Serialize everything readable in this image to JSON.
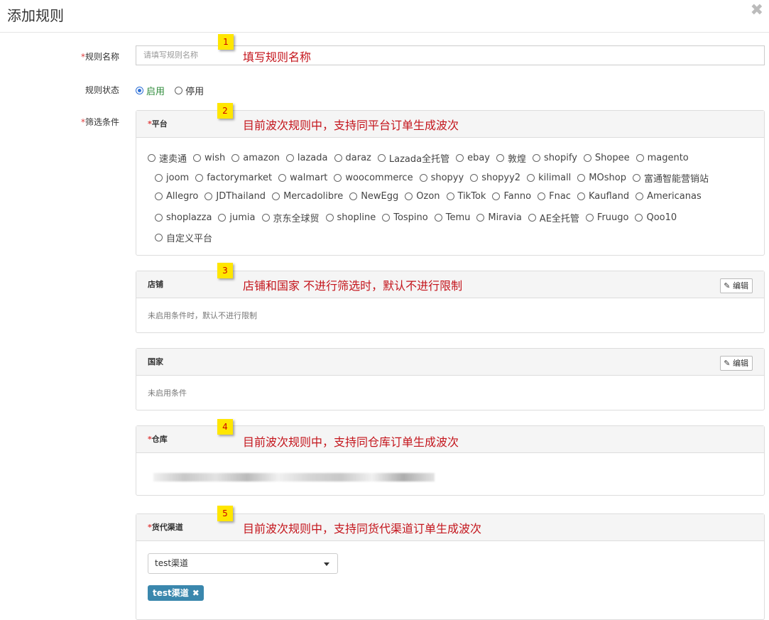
{
  "header": {
    "title": "添加规则",
    "close": "✖"
  },
  "form": {
    "name_label": "规则名称",
    "name_placeholder": "请填写规则名称",
    "status_label": "规则状态",
    "status_options": [
      "启用",
      "停用"
    ],
    "filter_label": "筛选条件",
    "required_mark": "*"
  },
  "platform_panel": {
    "title": "平台",
    "rows": [
      [
        "速卖通",
        "wish",
        "amazon",
        "lazada",
        "daraz",
        "Lazada全托管",
        "ebay",
        "敦煌",
        "shopify",
        "Shopee",
        "magento"
      ],
      [
        "joom",
        "factorymarket",
        "walmart",
        "woocommerce",
        "shopyy",
        "shopyy2",
        "kilimall",
        "MOshop",
        "富通智能营销站"
      ],
      [
        "Allegro",
        "JDThailand",
        "Mercadolibre",
        "NewEgg",
        "Ozon",
        "TikTok",
        "Fanno",
        "Fnac",
        "Kaufland",
        "Americanas"
      ],
      [
        "shoplazza",
        "jumia",
        "京东全球贸",
        "shopline",
        "Tospino",
        "Temu",
        "Miravia",
        "AE全托管",
        "Fruugo",
        "Qoo10"
      ],
      [
        "自定义平台"
      ]
    ]
  },
  "shop_panel": {
    "title": "店铺",
    "edit": "编辑",
    "hint": "未启用条件时，默认不进行限制"
  },
  "country_panel": {
    "title": "国家",
    "edit": "编辑",
    "hint": "未启用条件"
  },
  "warehouse_panel": {
    "title": "仓库"
  },
  "channel_panel": {
    "title": "货代渠道",
    "selected": "test渠道",
    "tag": "test渠道"
  },
  "annotations": [
    {
      "num": "1",
      "text": "填写规则名称"
    },
    {
      "num": "2",
      "text": "目前波次规则中，支持同平台订单生成波次"
    },
    {
      "num": "3",
      "text": "店铺和国家 不进行筛选时，默认不进行限制"
    },
    {
      "num": "4",
      "text": "目前波次规则中，支持同仓库订单生成波次"
    },
    {
      "num": "5",
      "text": "目前波次规则中，支持同货代渠道订单生成波次"
    }
  ],
  "colors": {
    "accent": "#2d6fd6",
    "tag": "#3a87ad",
    "note": "#c4151c",
    "badge": "#ffe600"
  }
}
